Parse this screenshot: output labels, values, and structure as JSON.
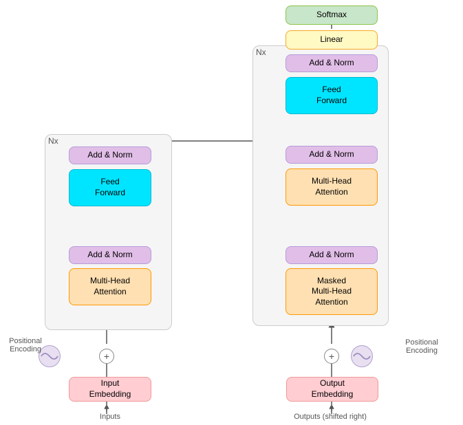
{
  "blocks": {
    "softmax": {
      "label": "Softmax",
      "bg": "#c8e6c9",
      "border": "#8bc34a"
    },
    "linear_top": {
      "label": "Linear",
      "bg": "#fff9c4",
      "border": "#f9a825"
    },
    "addnorm_enc3": {
      "label": "Add & Norm",
      "bg": "#e1bee7",
      "border": "#9c27b0"
    },
    "feedforward_enc": {
      "label": "Feed\nForward",
      "bg": "#00e5ff",
      "border": "#00b8d4"
    },
    "addnorm_enc2": {
      "label": "Add & Norm",
      "bg": "#e1bee7",
      "border": "#9c27b0"
    },
    "multihead_enc": {
      "label": "Multi-Head\nAttention",
      "bg": "#ffe0b2",
      "border": "#ff9800"
    },
    "addnorm_enc1": {
      "label": "Add & Norm",
      "bg": "#e1bee7",
      "border": "#9c27b0"
    },
    "masked_mha": {
      "label": "Masked\nMulti-Head\nAttention",
      "bg": "#ffe0b2",
      "border": "#ff9800"
    },
    "addnorm_dec2": {
      "label": "Add & Norm",
      "bg": "#e1bee7",
      "border": "#9c27b0"
    },
    "feedforward_dec": {
      "label": "Feed\nForward",
      "bg": "#00e5ff",
      "border": "#00b8d4"
    },
    "addnorm_dec1": {
      "label": "Add & Norm",
      "bg": "#e1bee7",
      "border": "#9c27b0"
    },
    "multihead_dec": {
      "label": "Multi-Head\nAttention",
      "bg": "#ffe0b2",
      "border": "#ff9800"
    },
    "input_embed": {
      "label": "Input\nEmbedding",
      "bg": "#ffcdd2",
      "border": "#e57373"
    },
    "output_embed": {
      "label": "Output\nEmbedding",
      "bg": "#ffcdd2",
      "border": "#e57373"
    },
    "inputs_label": "Inputs",
    "outputs_label": "Outputs (shifted right)",
    "pos_enc_left": "Positional\nEncoding",
    "pos_enc_right": "Positional\nEncoding",
    "nx_enc": "Nx",
    "nx_dec": "Nx"
  }
}
